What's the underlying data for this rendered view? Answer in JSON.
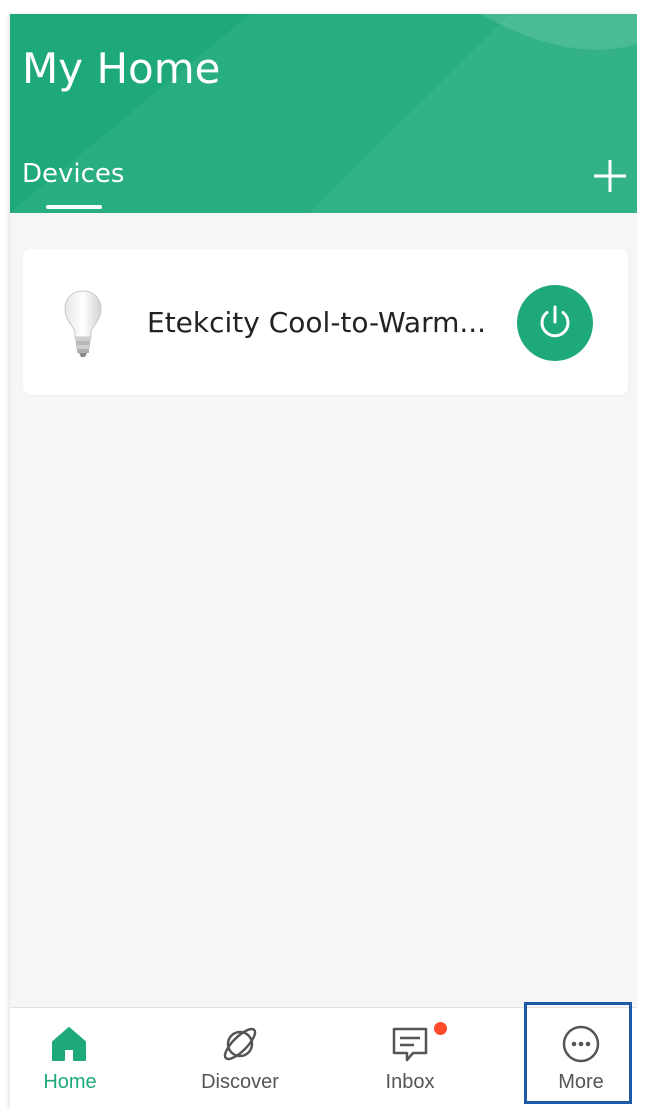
{
  "header": {
    "title": "My Home",
    "tabs": [
      {
        "label": "Devices",
        "active": true
      }
    ],
    "add_icon": "plus-icon"
  },
  "devices": [
    {
      "name": "Etekcity Cool-to-Warm...",
      "icon": "light-bulb-icon",
      "power_icon": "power-icon",
      "power_on": true
    }
  ],
  "bottom_nav": [
    {
      "label": "Home",
      "icon": "home-icon",
      "active": true
    },
    {
      "label": "Discover",
      "icon": "planet-icon",
      "active": false
    },
    {
      "label": "Inbox",
      "icon": "message-icon",
      "active": false,
      "badge": true
    },
    {
      "label": "More",
      "icon": "more-icon",
      "active": false,
      "highlighted": true
    }
  ],
  "colors": {
    "brand_green": "#1ea97c",
    "badge_red": "#ff4b2b",
    "highlight_blue": "#1c5aa8",
    "background": "#f6f6f6"
  }
}
